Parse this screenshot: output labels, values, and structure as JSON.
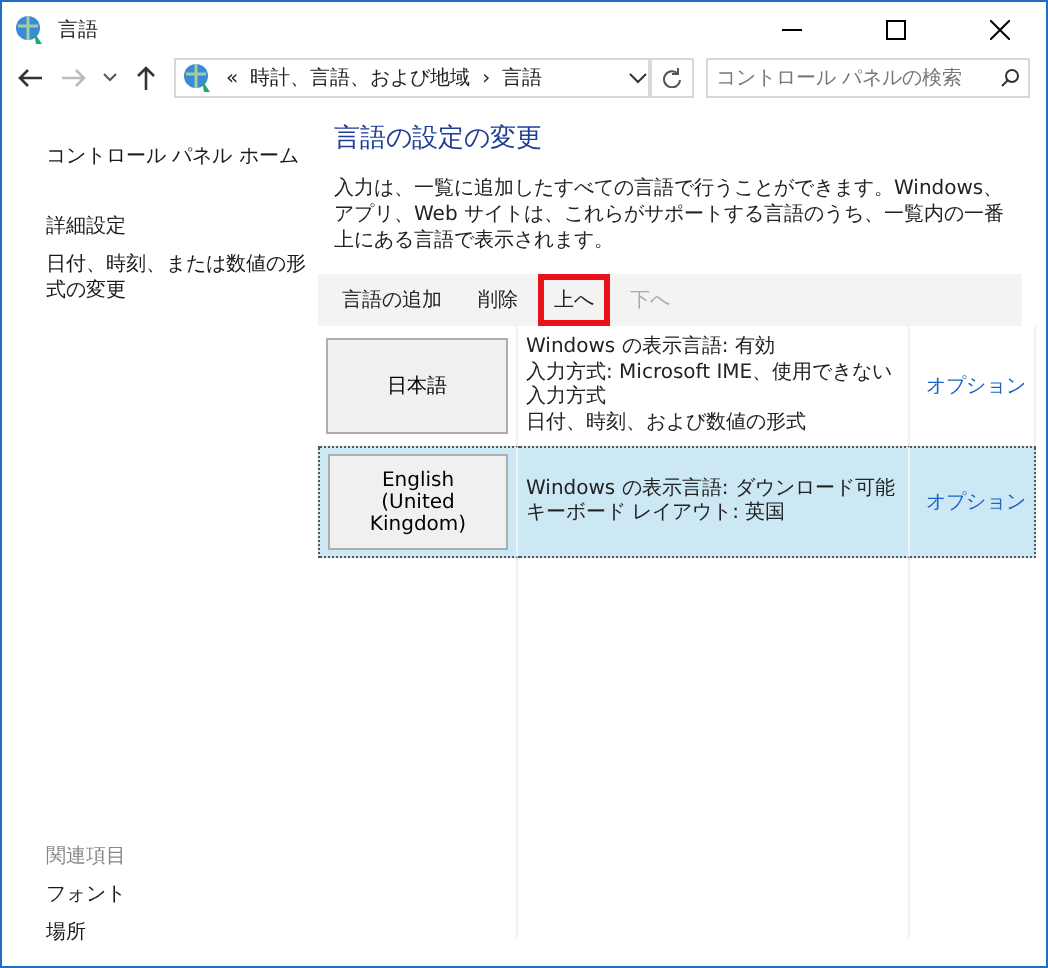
{
  "window": {
    "title": "言語"
  },
  "nav": {
    "breadcrumb": [
      {
        "label": "«"
      },
      {
        "label": "時計、言語、および地域"
      },
      {
        "label": "›"
      },
      {
        "label": "言語"
      }
    ],
    "search": {
      "placeholder": "コントロール パネルの検索"
    }
  },
  "sidebar": {
    "items": [
      {
        "label": "コントロール パネル ホーム"
      },
      {
        "label": "詳細設定"
      },
      {
        "label": "日付、時刻、または数値の形式の変更"
      }
    ],
    "related": {
      "heading": "関連項目",
      "items": [
        {
          "label": "フォント"
        },
        {
          "label": "場所"
        }
      ]
    }
  },
  "main": {
    "title": "言語の設定の変更",
    "description": "入力は、一覧に追加したすべての言語で行うことができます。Windows、アプリ、Web サイトは、これらがサポートする言語のうち、一覧内の一番上にある言語で表示されます。",
    "toolbar": [
      {
        "label": "言語の追加",
        "disabled": false,
        "highlighted": false
      },
      {
        "label": "削除",
        "disabled": false,
        "highlighted": false
      },
      {
        "label": "上へ",
        "disabled": false,
        "highlighted": true
      },
      {
        "label": "下へ",
        "disabled": true,
        "highlighted": false
      }
    ],
    "languages": [
      {
        "name": "日本語",
        "selected": false,
        "details": [
          "Windows の表示言語: 有効",
          "入力方式: Microsoft IME、使用できない入力方式",
          "日付、時刻、および数値の形式"
        ],
        "options": "オプション"
      },
      {
        "name": "English (United Kingdom)",
        "selected": true,
        "details": [
          "Windows の表示言語: ダウンロード可能",
          "キーボード レイアウト: 英国"
        ],
        "options": "オプション"
      }
    ]
  }
}
